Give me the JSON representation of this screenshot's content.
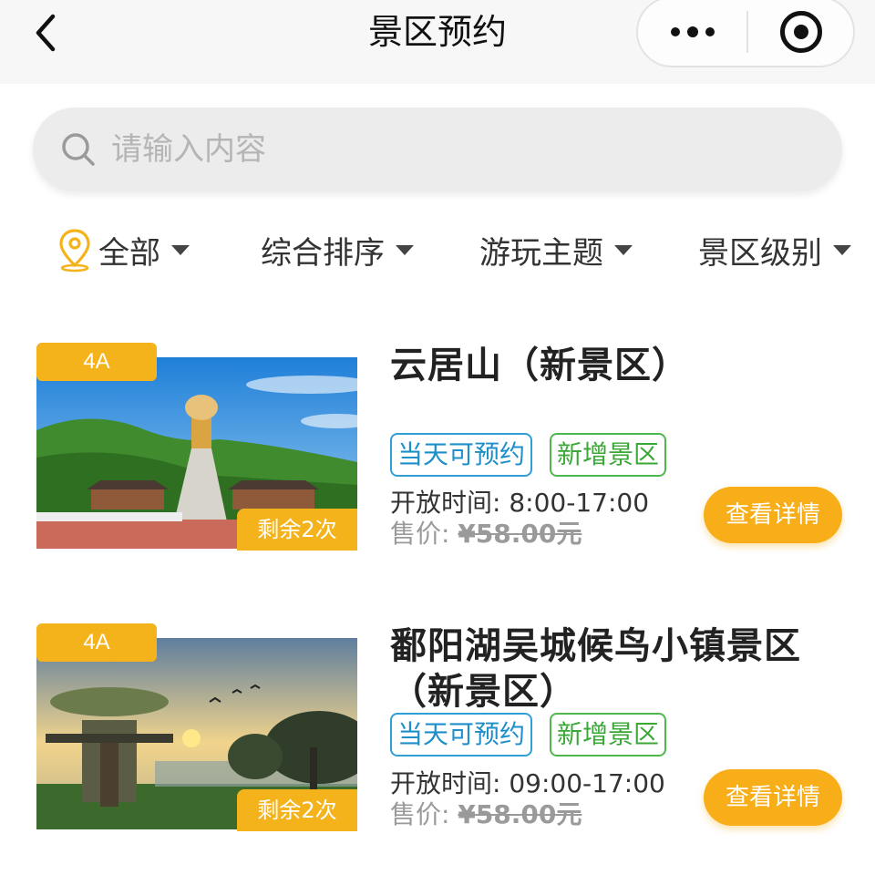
{
  "nav": {
    "title": "景区预约",
    "back_icon": "chevron-left-icon",
    "more_icon": "more-dots-icon",
    "close_icon": "target-icon"
  },
  "search": {
    "placeholder": "请输入内容",
    "value": ""
  },
  "filters": [
    {
      "label": "全部",
      "icon": "location-pin-icon"
    },
    {
      "label": "综合排序"
    },
    {
      "label": "游玩主题"
    },
    {
      "label": "景区级别"
    }
  ],
  "colors": {
    "accent": "#f4b21b",
    "tag_blue": "#2f9fd6",
    "tag_green": "#4fb84a"
  },
  "spots": [
    {
      "level": "4A",
      "title": "云居山（新景区）",
      "tags": [
        "当天可预约",
        "新增景区"
      ],
      "open_time": "开放时间:  8:00-17:00",
      "price_label": "售价: ",
      "price_value": "¥58.00元",
      "remaining": "剩余2次",
      "detail_button": "查看详情"
    },
    {
      "level": "4A",
      "title": "鄱阳湖吴城候鸟小镇景区（新景区）",
      "tags": [
        "当天可预约",
        "新增景区"
      ],
      "open_time": "开放时间:  09:00-17:00",
      "price_label": "售价: ",
      "price_value": "¥58.00元",
      "remaining": "剩余2次",
      "detail_button": "查看详情"
    }
  ]
}
